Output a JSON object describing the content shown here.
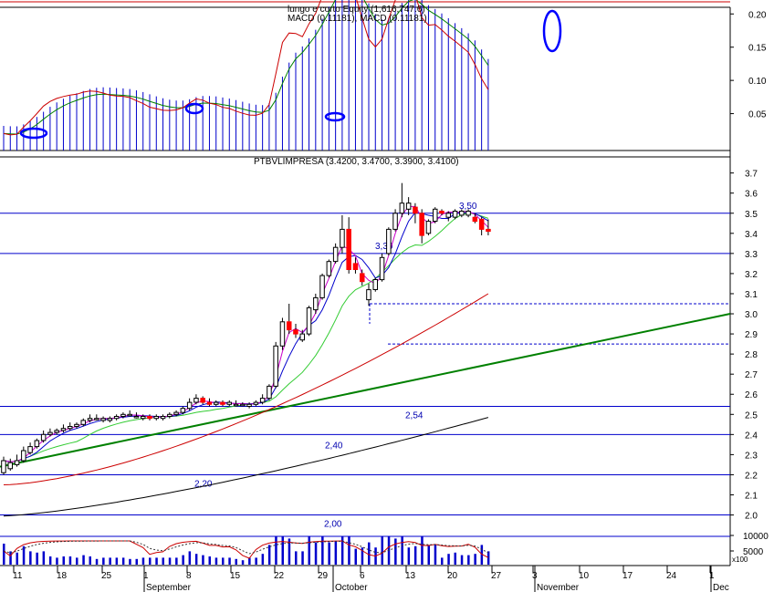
{
  "chart_data": {
    "type": "candlestick",
    "colors": {
      "frame": "#000000",
      "volume": "#0000cc",
      "candle_up": "#ffffff",
      "candle_down": "#ff0000",
      "macd_histogram": "#0000cc",
      "macd_line": "#cc0000",
      "signal_line": "#008000",
      "ma_short": "#0000cc",
      "ma_medium": "#cc00cc",
      "ma_green": "#33cc33",
      "ma_red": "#cc0000",
      "ma_black": "#000000",
      "trendline": "#008000",
      "level_line": "#0000cc",
      "highlight_ellipse": "#0000ff",
      "level_text": "#0000b0"
    },
    "macd_panel": {
      "title": "lungo e corto Equity (1,616,747.6)",
      "subtitle": "MACD (0.11181), MACD (0.11181)",
      "y_ticks": [
        "0.20",
        "0.15",
        "0.10",
        "0.05"
      ],
      "y_tick_values": [
        0.2,
        0.15,
        0.1,
        0.05
      ],
      "ylim": [
        0.0,
        0.21
      ]
    },
    "price_panel": {
      "title": "PTBVLIMPRESA (3.4200, 3.4700, 3.3900, 3.4100)",
      "y_ticks": [
        "3.7",
        "3.6",
        "3.5",
        "3.4",
        "3.3",
        "3.2",
        "3.1",
        "3.0",
        "2.9",
        "2.8",
        "2.7",
        "2.6",
        "2.5",
        "2.4",
        "2.3",
        "2.2",
        "2.1",
        "2.0"
      ],
      "ylim": [
        1.93,
        3.78
      ],
      "levels": [
        {
          "value": 3.5,
          "label": "3,50"
        },
        {
          "value": 3.3,
          "label": "3,30"
        },
        {
          "value": 2.54,
          "label": "2,54"
        },
        {
          "value": 2.4,
          "label": "2,40"
        },
        {
          "value": 2.2,
          "label": "2,20"
        },
        {
          "value": 2.0,
          "label": "2,00"
        }
      ],
      "dashed_levels": [
        3.05,
        2.85
      ]
    },
    "volume_panel": {
      "y_ticks": [
        "10000",
        "5000"
      ],
      "unit": "x100"
    },
    "x_axis": {
      "day_labels": [
        "11",
        "18",
        "25",
        "1",
        "8",
        "15",
        "22",
        "29",
        "6",
        "13",
        "20",
        "27",
        "3",
        "10",
        "17",
        "24",
        "1"
      ],
      "month_labels": [
        "September",
        "October",
        "November",
        "Dec"
      ]
    },
    "candles": [
      {
        "o": 2.21,
        "h": 2.29,
        "l": 2.2,
        "c": 2.27
      },
      {
        "o": 2.23,
        "h": 2.28,
        "l": 2.22,
        "c": 2.26
      },
      {
        "o": 2.25,
        "h": 2.3,
        "l": 2.24,
        "c": 2.27
      },
      {
        "o": 2.27,
        "h": 2.34,
        "l": 2.26,
        "c": 2.32
      },
      {
        "o": 2.31,
        "h": 2.36,
        "l": 2.3,
        "c": 2.34
      },
      {
        "o": 2.34,
        "h": 2.38,
        "l": 2.33,
        "c": 2.37
      },
      {
        "o": 2.37,
        "h": 2.42,
        "l": 2.36,
        "c": 2.4
      },
      {
        "o": 2.4,
        "h": 2.43,
        "l": 2.39,
        "c": 2.41
      },
      {
        "o": 2.41,
        "h": 2.43,
        "l": 2.4,
        "c": 2.42
      },
      {
        "o": 2.42,
        "h": 2.45,
        "l": 2.41,
        "c": 2.43
      },
      {
        "o": 2.43,
        "h": 2.46,
        "l": 2.42,
        "c": 2.44
      },
      {
        "o": 2.44,
        "h": 2.46,
        "l": 2.43,
        "c": 2.45
      },
      {
        "o": 2.45,
        "h": 2.48,
        "l": 2.44,
        "c": 2.47
      },
      {
        "o": 2.47,
        "h": 2.5,
        "l": 2.46,
        "c": 2.48
      },
      {
        "o": 2.48,
        "h": 2.5,
        "l": 2.47,
        "c": 2.48
      },
      {
        "o": 2.47,
        "h": 2.49,
        "l": 2.46,
        "c": 2.48
      },
      {
        "o": 2.47,
        "h": 2.49,
        "l": 2.46,
        "c": 2.48
      },
      {
        "o": 2.48,
        "h": 2.5,
        "l": 2.47,
        "c": 2.49
      },
      {
        "o": 2.49,
        "h": 2.51,
        "l": 2.48,
        "c": 2.5
      },
      {
        "o": 2.5,
        "h": 2.52,
        "l": 2.49,
        "c": 2.5
      },
      {
        "o": 2.49,
        "h": 2.51,
        "l": 2.48,
        "c": 2.49
      },
      {
        "o": 2.48,
        "h": 2.5,
        "l": 2.47,
        "c": 2.49
      },
      {
        "o": 2.49,
        "h": 2.5,
        "l": 2.47,
        "c": 2.48
      },
      {
        "o": 2.48,
        "h": 2.5,
        "l": 2.47,
        "c": 2.49
      },
      {
        "o": 2.48,
        "h": 2.5,
        "l": 2.47,
        "c": 2.49
      },
      {
        "o": 2.49,
        "h": 2.51,
        "l": 2.48,
        "c": 2.5
      },
      {
        "o": 2.5,
        "h": 2.52,
        "l": 2.49,
        "c": 2.51
      },
      {
        "o": 2.51,
        "h": 2.54,
        "l": 2.5,
        "c": 2.53
      },
      {
        "o": 2.53,
        "h": 2.58,
        "l": 2.52,
        "c": 2.56
      },
      {
        "o": 2.56,
        "h": 2.6,
        "l": 2.55,
        "c": 2.58
      },
      {
        "o": 2.58,
        "h": 2.59,
        "l": 2.55,
        "c": 2.56
      },
      {
        "o": 2.56,
        "h": 2.58,
        "l": 2.54,
        "c": 2.55
      },
      {
        "o": 2.55,
        "h": 2.57,
        "l": 2.54,
        "c": 2.56
      },
      {
        "o": 2.56,
        "h": 2.57,
        "l": 2.54,
        "c": 2.55
      },
      {
        "o": 2.55,
        "h": 2.57,
        "l": 2.54,
        "c": 2.56
      },
      {
        "o": 2.55,
        "h": 2.57,
        "l": 2.54,
        "c": 2.55
      },
      {
        "o": 2.55,
        "h": 2.56,
        "l": 2.54,
        "c": 2.55
      },
      {
        "o": 2.54,
        "h": 2.56,
        "l": 2.53,
        "c": 2.55
      },
      {
        "o": 2.55,
        "h": 2.57,
        "l": 2.54,
        "c": 2.56
      },
      {
        "o": 2.56,
        "h": 2.6,
        "l": 2.55,
        "c": 2.58
      },
      {
        "o": 2.58,
        "h": 2.65,
        "l": 2.57,
        "c": 2.64
      },
      {
        "o": 2.64,
        "h": 2.86,
        "l": 2.63,
        "c": 2.84
      },
      {
        "o": 2.84,
        "h": 2.98,
        "l": 2.82,
        "c": 2.96
      },
      {
        "o": 2.96,
        "h": 3.05,
        "l": 2.9,
        "c": 2.92
      },
      {
        "o": 2.92,
        "h": 2.95,
        "l": 2.88,
        "c": 2.9
      },
      {
        "o": 2.87,
        "h": 2.92,
        "l": 2.86,
        "c": 2.9
      },
      {
        "o": 2.9,
        "h": 3.04,
        "l": 2.89,
        "c": 3.03
      },
      {
        "o": 3.02,
        "h": 3.1,
        "l": 3.0,
        "c": 3.08
      },
      {
        "o": 3.08,
        "h": 3.2,
        "l": 3.07,
        "c": 3.19
      },
      {
        "o": 3.19,
        "h": 3.27,
        "l": 3.18,
        "c": 3.26
      },
      {
        "o": 3.26,
        "h": 3.35,
        "l": 3.25,
        "c": 3.33
      },
      {
        "o": 3.33,
        "h": 3.49,
        "l": 3.3,
        "c": 3.42
      },
      {
        "o": 3.42,
        "h": 3.48,
        "l": 3.2,
        "c": 3.22
      },
      {
        "o": 3.25,
        "h": 3.28,
        "l": 3.2,
        "c": 3.22
      },
      {
        "o": 3.2,
        "h": 3.22,
        "l": 3.14,
        "c": 3.16
      },
      {
        "o": 3.07,
        "h": 3.15,
        "l": 3.04,
        "c": 3.12
      },
      {
        "o": 3.12,
        "h": 3.18,
        "l": 3.11,
        "c": 3.17
      },
      {
        "o": 3.17,
        "h": 3.3,
        "l": 3.16,
        "c": 3.28
      },
      {
        "o": 3.3,
        "h": 3.43,
        "l": 3.29,
        "c": 3.42
      },
      {
        "o": 3.42,
        "h": 3.52,
        "l": 3.41,
        "c": 3.5
      },
      {
        "o": 3.5,
        "h": 3.65,
        "l": 3.48,
        "c": 3.55
      },
      {
        "o": 3.52,
        "h": 3.58,
        "l": 3.49,
        "c": 3.55
      },
      {
        "o": 3.53,
        "h": 3.55,
        "l": 3.45,
        "c": 3.5
      },
      {
        "o": 3.5,
        "h": 3.52,
        "l": 3.35,
        "c": 3.39
      },
      {
        "o": 3.4,
        "h": 3.47,
        "l": 3.39,
        "c": 3.46
      },
      {
        "o": 3.46,
        "h": 3.53,
        "l": 3.45,
        "c": 3.52
      },
      {
        "o": 3.51,
        "h": 3.52,
        "l": 3.49,
        "c": 3.5
      },
      {
        "o": 3.48,
        "h": 3.51,
        "l": 3.46,
        "c": 3.5
      },
      {
        "o": 3.48,
        "h": 3.52,
        "l": 3.47,
        "c": 3.51
      },
      {
        "o": 3.49,
        "h": 3.52,
        "l": 3.48,
        "c": 3.51
      },
      {
        "o": 3.49,
        "h": 3.52,
        "l": 3.48,
        "c": 3.51
      },
      {
        "o": 3.48,
        "h": 3.5,
        "l": 3.45,
        "c": 3.46
      },
      {
        "o": 3.47,
        "h": 3.48,
        "l": 3.39,
        "c": 3.42
      },
      {
        "o": 3.42,
        "h": 3.47,
        "l": 3.39,
        "c": 3.41
      }
    ]
  }
}
